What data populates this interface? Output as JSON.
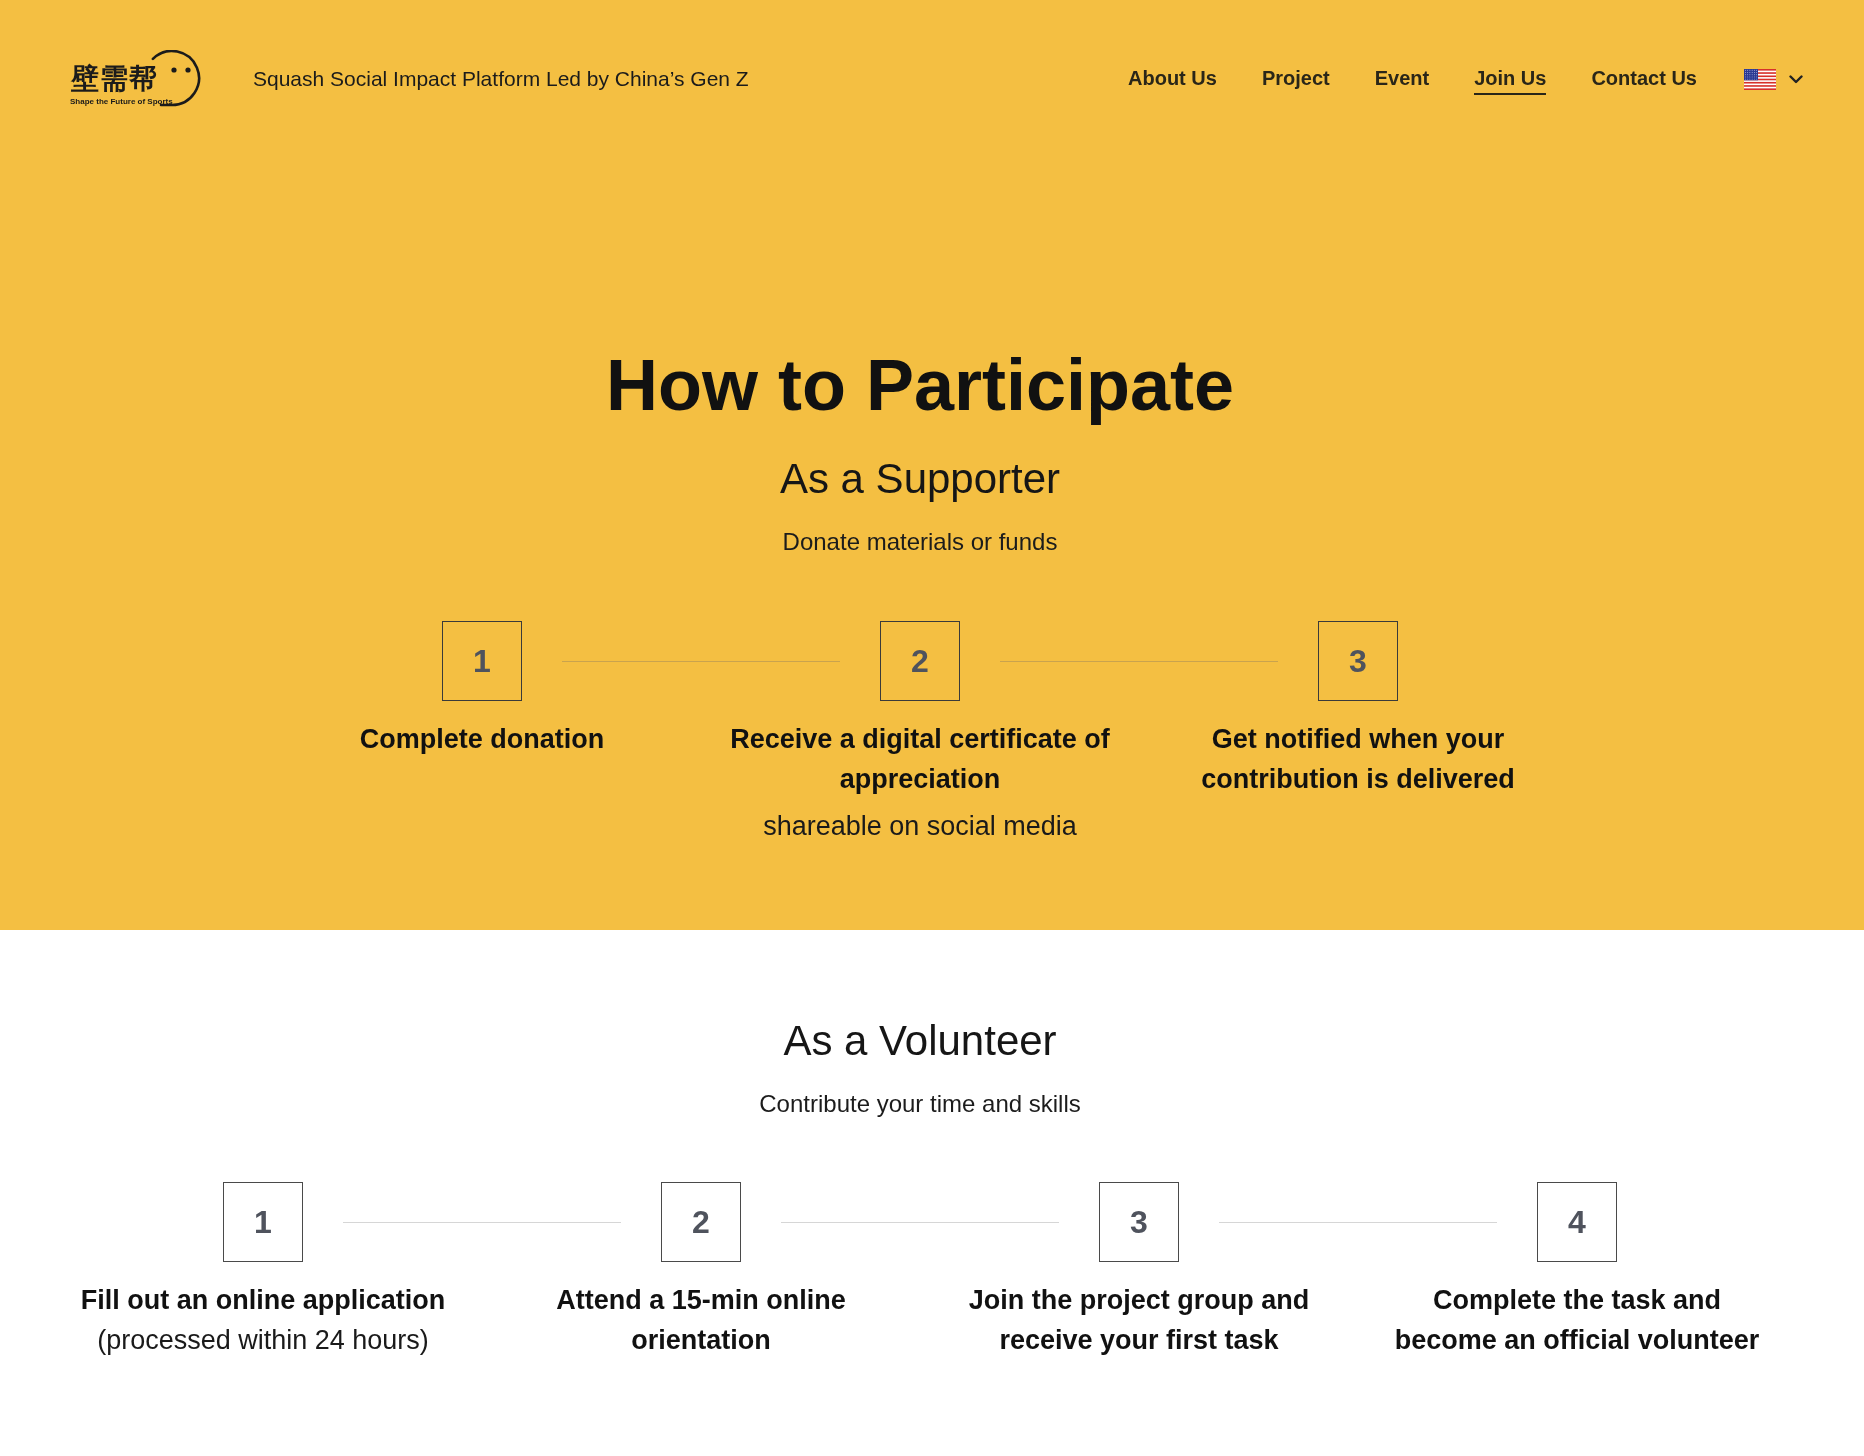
{
  "header": {
    "logo": {
      "wordmark": "壁需帮",
      "slogan": "Shape the Future of Sports"
    },
    "tagline": "Squash Social Impact Platform Led by China’s Gen Z",
    "nav": [
      {
        "label": "About Us",
        "selected": false
      },
      {
        "label": "Project",
        "selected": false
      },
      {
        "label": "Event",
        "selected": false
      },
      {
        "label": "Join Us",
        "selected": true
      },
      {
        "label": "Contact Us",
        "selected": false
      }
    ]
  },
  "title": "How to Participate",
  "sections": [
    {
      "kind": "highlight",
      "heading": "As a Supporter",
      "subheading": "Donate materials or funds",
      "steps": [
        {
          "number": "1",
          "title": "Complete donation"
        },
        {
          "number": "2",
          "title": "Receive a digital certificate of appreciation",
          "note": "shareable on social media"
        },
        {
          "number": "3",
          "title": "Get notified when your contribution is delivered"
        }
      ]
    },
    {
      "kind": "plain",
      "heading": "As a Volunteer",
      "subheading": "Contribute your time and skills",
      "steps": [
        {
          "number": "1",
          "title": "Fill out an online application",
          "note": "(processed within 24 hours)"
        },
        {
          "number": "2",
          "title": "Attend a 15-min online orientation"
        },
        {
          "number": "3",
          "title": "Join the project group and receive your first task"
        },
        {
          "number": "4",
          "title": "Complete the task and become an official volunteer"
        }
      ]
    }
  ]
}
